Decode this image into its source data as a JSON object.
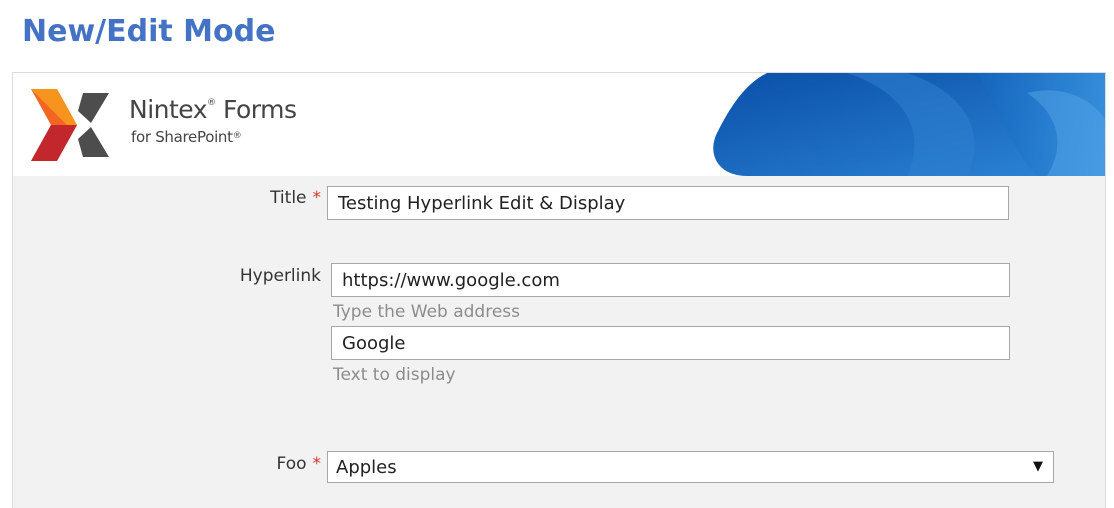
{
  "heading": "New/Edit Mode",
  "brand": {
    "product": "Nintex",
    "product_suffix": "Forms",
    "tagline": "for SharePoint",
    "reg_mark": "®",
    "colors": {
      "logo_orange": "#f15a24",
      "logo_red": "#c1272d",
      "logo_gray": "#4d4d4d",
      "banner_blue": "#1b6ec2"
    }
  },
  "form": {
    "title": {
      "label": "Title",
      "required_mark": "*",
      "value": "Testing Hyperlink Edit & Display"
    },
    "hyperlink": {
      "label": "Hyperlink",
      "url_value": "https://www.google.com",
      "url_hint": "Type the Web address",
      "text_value": "Google",
      "text_hint": "Text to display"
    },
    "foo": {
      "label": "Foo",
      "required_mark": "*",
      "selected": "Apples",
      "arrow_icon": "▼"
    }
  }
}
